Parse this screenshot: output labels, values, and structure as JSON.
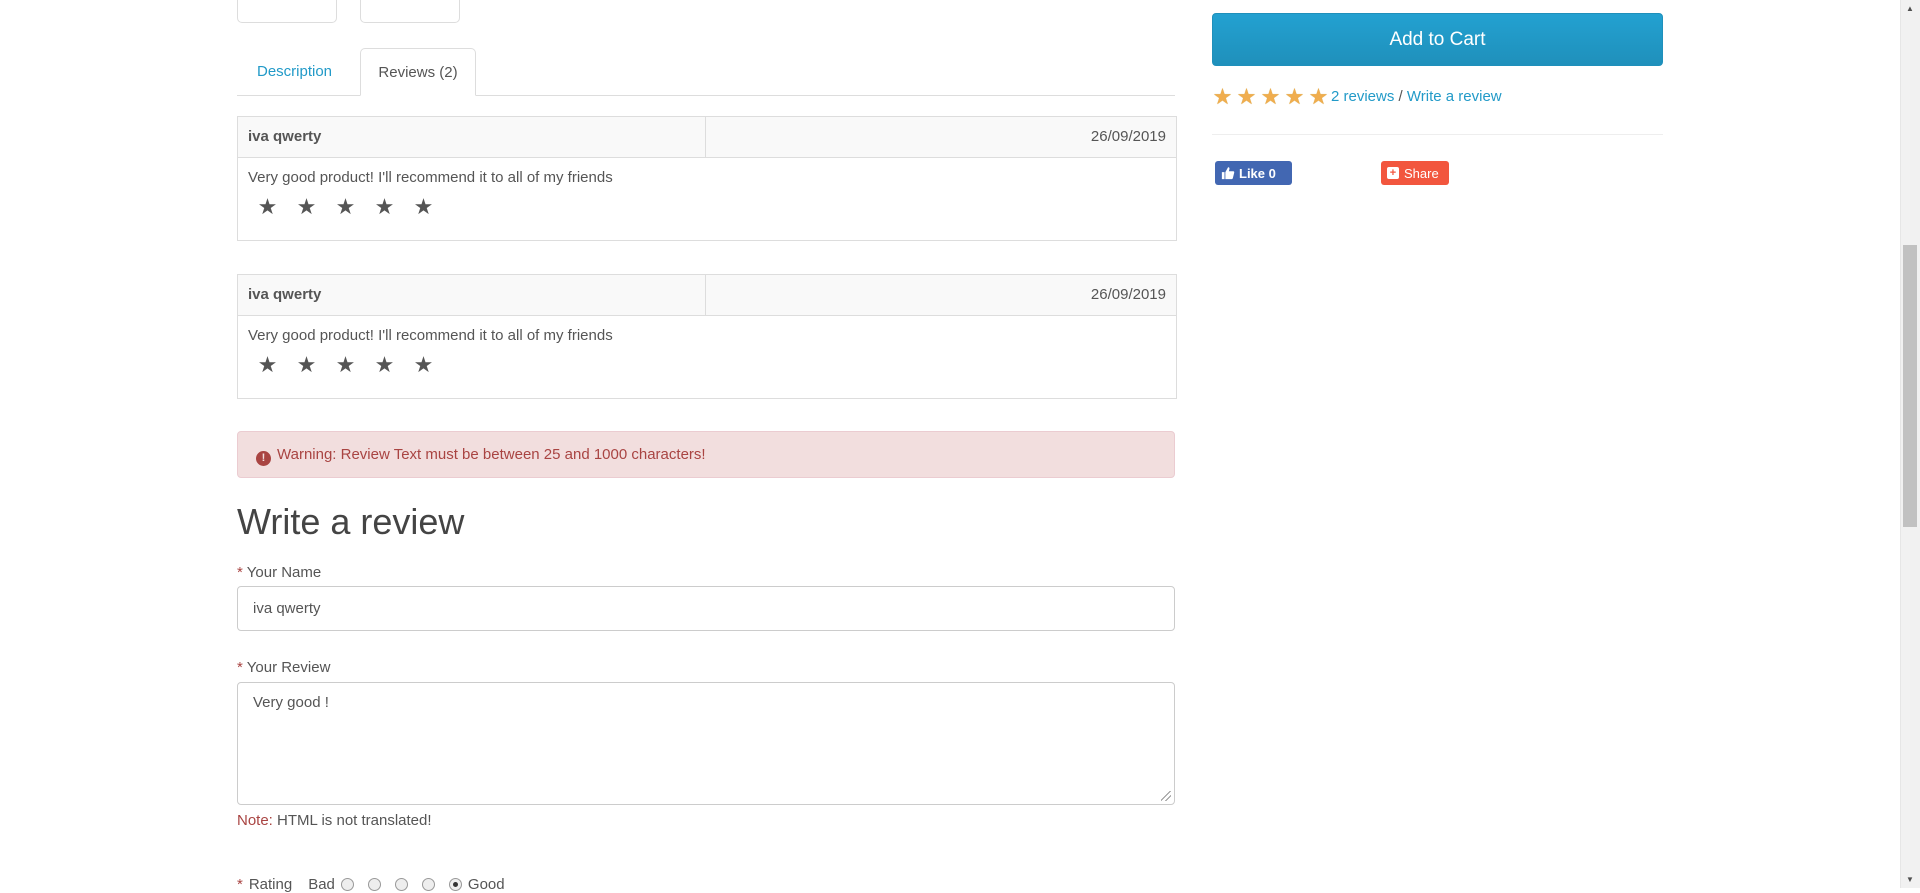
{
  "tabs": [
    {
      "label": "Description"
    },
    {
      "label": "Reviews (2)"
    }
  ],
  "reviews": [
    {
      "author": "iva qwerty",
      "date": "26/09/2019",
      "text": "Very good product! I'll recommend it to all of my friends",
      "rating": 5
    },
    {
      "author": "iva qwerty",
      "date": "26/09/2019",
      "text": "Very good product! I'll recommend it to all of my friends",
      "rating": 5
    }
  ],
  "alert": {
    "text": "Warning: Review Text must be between 25 and 1000 characters!"
  },
  "form": {
    "title": "Write a review",
    "required_mark": "*",
    "name_label": "Your Name",
    "name_value": "iva qwerty",
    "review_label": "Your Review",
    "review_value": "Very good !",
    "note_label": "Note:",
    "note_text": "HTML is not translated!",
    "rating_label": "Rating",
    "rating_bad": "Bad",
    "rating_good": "Good",
    "rating_selected": 5
  },
  "product": {
    "add_to_cart": "Add to Cart",
    "rating": 5,
    "reviews_link": "2 reviews",
    "separator": "/",
    "write_review_link": "Write a review"
  },
  "social": {
    "like_label": "Like 0",
    "share_label": "Share"
  },
  "colors": {
    "link": "#229ac8",
    "alert_bg": "#f2dede",
    "alert_text": "#a94442",
    "button": "#229ac8",
    "star_gold": "#f0ad4e",
    "facebook": "#4267b2",
    "share": "#f2563e"
  },
  "icons": {
    "warning": "exclamation-circle-icon",
    "star": "star-icon",
    "like": "thumbs-up-icon",
    "share": "plus-square-icon"
  }
}
